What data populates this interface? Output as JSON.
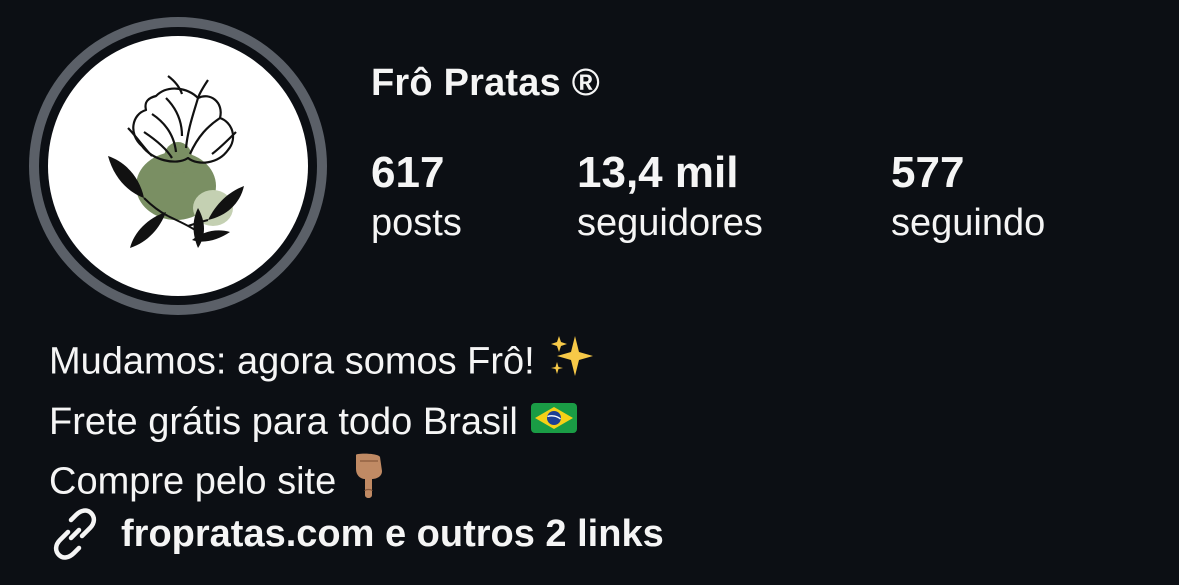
{
  "profile": {
    "name": "Frô Pratas ®",
    "avatar_icon": "flower-logo-icon"
  },
  "stats": [
    {
      "number": "617",
      "label": "posts"
    },
    {
      "number": "13,4 mil",
      "label": "seguidores"
    },
    {
      "number": "577",
      "label": "seguindo"
    }
  ],
  "bio": {
    "lines": [
      {
        "text": "Mudamos: agora somos Frô!",
        "emoji": "sparkles-icon"
      },
      {
        "text": "Frete grátis para todo Brasil",
        "emoji": "brazil-flag-icon"
      },
      {
        "text": "Compre pelo site",
        "emoji": "pointing-down-hand-icon"
      }
    ]
  },
  "link": {
    "text": "fropratas.com e outros 2 links",
    "icon": "link-icon"
  },
  "colors": {
    "background": "#0c0f14",
    "text": "#f5f5f5",
    "ring": "#5b6068",
    "leaf_green": "#7a8f63"
  }
}
